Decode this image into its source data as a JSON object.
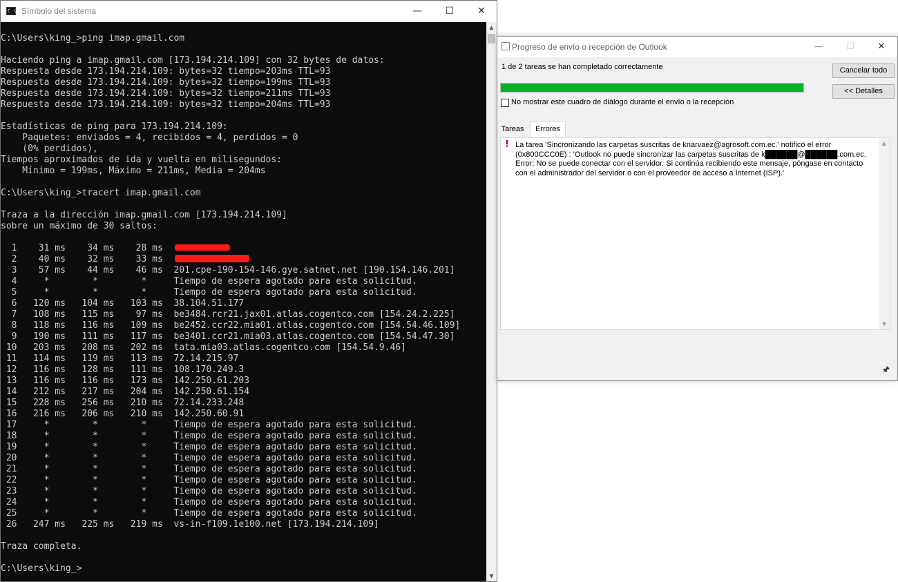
{
  "cmd": {
    "title": "Símbolo del sistema",
    "icon_label": "C:\\.",
    "controls": {
      "minimize": "—",
      "maximize": "☐",
      "close": "✕"
    },
    "lines": [
      "C:\\Users\\king_>ping imap.gmail.com",
      "",
      "Haciendo ping a imap.gmail.com [173.194.214.109] con 32 bytes de datos:",
      "Respuesta desde 173.194.214.109: bytes=32 tiempo=203ms TTL=93",
      "Respuesta desde 173.194.214.109: bytes=32 tiempo=199ms TTL=93",
      "Respuesta desde 173.194.214.109: bytes=32 tiempo=211ms TTL=93",
      "Respuesta desde 173.194.214.109: bytes=32 tiempo=204ms TTL=93",
      "",
      "Estadísticas de ping para 173.194.214.109:",
      "    Paquetes: enviados = 4, recibidos = 4, perdidos = 0",
      "    (0% perdidos),",
      "Tiempos aproximados de ida y vuelta en milisegundos:",
      "    Mínimo = 199ms, Máximo = 211ms, Media = 204ms",
      "",
      "C:\\Users\\king_>tracert imap.gmail.com",
      "",
      "Traza a la dirección imap.gmail.com [173.194.214.109]",
      "sobre un máximo de 30 saltos:",
      "",
      "  1    31 ms    34 ms    28 ms",
      "  2    40 ms    32 ms    33 ms",
      "  3    57 ms    44 ms    46 ms  201.cpe-190-154-146.gye.satnet.net [190.154.146.201]",
      "  4     *        *        *     Tiempo de espera agotado para esta solicitud.",
      "  5     *        *        *     Tiempo de espera agotado para esta solicitud.",
      "  6   120 ms   104 ms   103 ms  38.104.51.177",
      "  7   108 ms   115 ms    97 ms  be3484.rcr21.jax01.atlas.cogentco.com [154.24.2.225]",
      "  8   118 ms   116 ms   109 ms  be2452.ccr22.mia01.atlas.cogentco.com [154.54.46.109]",
      "  9   190 ms   111 ms   117 ms  be3401.ccr21.mia03.atlas.cogentco.com [154.54.47.30]",
      " 10   203 ms   208 ms   202 ms  tata.mia03.atlas.cogentco.com [154.54.9.46]",
      " 11   114 ms   119 ms   113 ms  72.14.215.97",
      " 12   116 ms   128 ms   111 ms  108.170.249.3",
      " 13   116 ms   116 ms   173 ms  142.250.61.203",
      " 14   212 ms   217 ms   204 ms  142.250.61.154",
      " 15   228 ms   256 ms   210 ms  72.14.233.248",
      " 16   216 ms   206 ms   210 ms  142.250.60.91",
      " 17     *        *        *     Tiempo de espera agotado para esta solicitud.",
      " 18     *        *        *     Tiempo de espera agotado para esta solicitud.",
      " 19     *        *        *     Tiempo de espera agotado para esta solicitud.",
      " 20     *        *        *     Tiempo de espera agotado para esta solicitud.",
      " 21     *        *        *     Tiempo de espera agotado para esta solicitud.",
      " 22     *        *        *     Tiempo de espera agotado para esta solicitud.",
      " 23     *        *        *     Tiempo de espera agotado para esta solicitud.",
      " 24     *        *        *     Tiempo de espera agotado para esta solicitud.",
      " 25     *        *        *     Tiempo de espera agotado para esta solicitud.",
      " 26   247 ms   225 ms   219 ms  vs-in-f109.1e100.net [173.194.214.109]",
      "",
      "Traza completa.",
      "",
      "C:\\Users\\king_>"
    ]
  },
  "outlook": {
    "title": "Progreso de envío o recepción de Outlook",
    "controls": {
      "minimize": "—",
      "maximize": "☐",
      "close": "✕"
    },
    "status": "1 de 2 tareas se han completado correctamente",
    "progress": 1.0,
    "progress_color": "#06b025",
    "cancel_all": "Cancelar todo",
    "details": "<< Detalles",
    "checkbox_label": "No mostrar este cuadro de diálogo durante el envío o la recepción",
    "checkbox_checked": false,
    "tabs": [
      "Tareas",
      "Errores"
    ],
    "active_tab": "Errores",
    "error_icon": "exclamation-icon",
    "error_message": "La tarea 'Sincronizando las carpetas suscritas de knarvaez@agrosoft.com.ec.' notificó el error (0x800CCC0E) : 'Outlook no puede sincronizar las carpetas suscritas de k██████@██████.com.ec. Error: No se puede conectar con el servidor. Si continúa recibiendo este mensaje, póngase en contacto con el administrador del servidor o con el proveedor de acceso a Internet (ISP).'",
    "pin_icon": "pushpin-icon"
  },
  "colors": {
    "console_bg": "#0c0c0c",
    "console_text": "#cccccc",
    "redaction": "#ff1a1a"
  }
}
